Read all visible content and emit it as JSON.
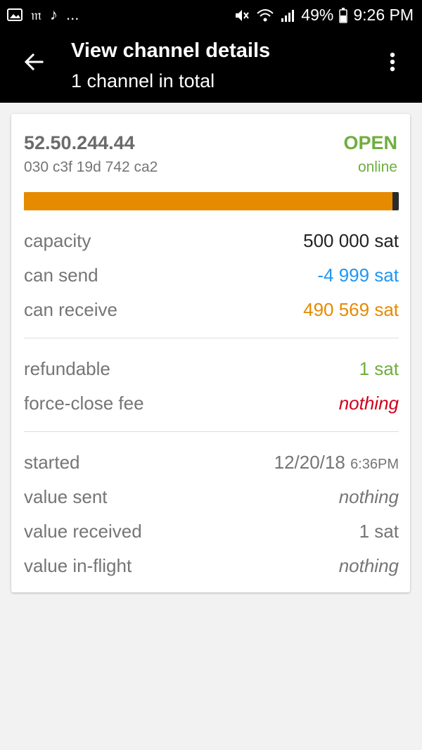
{
  "status_bar": {
    "left_icons": [
      "image-icon",
      "m-icon",
      "music-note-icon"
    ],
    "overflow": "...",
    "battery": "49%",
    "time": "9:26 PM"
  },
  "app_bar": {
    "title": "View channel details",
    "subtitle": "1 channel in total"
  },
  "channel": {
    "address": "52.50.244.44",
    "node_id": "030 c3f 19d 742 ca2",
    "state": "OPEN",
    "state_sub": "online",
    "balance_ratio": 0.984,
    "capacity_label": "capacity",
    "capacity_value": "500 000 sat",
    "can_send_label": "can send",
    "can_send_value": "-4 999 sat",
    "can_receive_label": "can receive",
    "can_receive_value": "490 569 sat",
    "refundable_label": "refundable",
    "refundable_value": "1 sat",
    "force_close_label": "force-close fee",
    "force_close_value": "nothing",
    "started_label": "started",
    "started_date": "12/20/18",
    "started_time": "6:36PM",
    "value_sent_label": "value sent",
    "value_sent_value": "nothing",
    "value_received_label": "value received",
    "value_received_value": "1 sat",
    "value_inflight_label": "value in-flight",
    "value_inflight_value": "nothing"
  },
  "colors": {
    "green": "#6fae3f",
    "blue": "#2196f3",
    "orange": "#e68a00",
    "red": "#d0021b"
  }
}
